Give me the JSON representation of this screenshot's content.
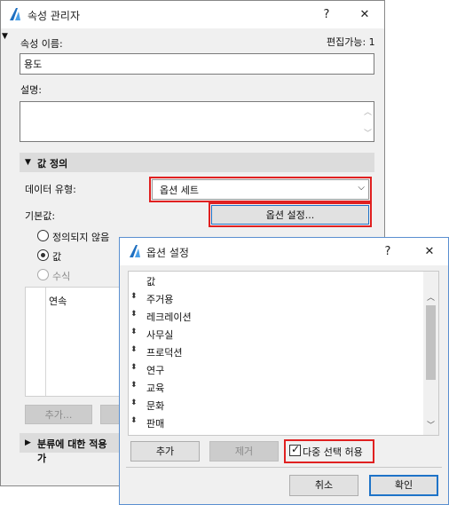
{
  "main": {
    "title": "속성 관리자",
    "help": "?",
    "close": "✕",
    "editable": "편집가능: 1",
    "name_label": "속성 이름:",
    "name_value": "용도",
    "desc_label": "설명:",
    "desc_value": "",
    "value_def": "값 정의",
    "data_type_label": "데이터 유형:",
    "data_type_value": "옵션 세트",
    "default_label": "기본값:",
    "option_settings": "옵션 설정...",
    "radio_undefined": "정의되지 않음",
    "radio_value": "값",
    "radio_formula": "수식",
    "default_value_item": "연속",
    "add_btn": "추가...",
    "classification": "분류에 대한 적용 가"
  },
  "options": {
    "title": "옵션 설정",
    "help": "?",
    "close": "✕",
    "header": "값",
    "items": [
      "주거용",
      "레크레이션",
      "사무실",
      "프로덕션",
      "연구",
      "교육",
      "문화",
      "판매"
    ],
    "add": "추가",
    "remove": "제거",
    "multi_select": "다중 선택 허용",
    "cancel": "취소",
    "ok": "확인"
  },
  "colors": {
    "highlight": "#e02020",
    "focus": "#1e73c8"
  },
  "icons": {
    "app": "archicad-icon",
    "chevron": "chevron-down-icon",
    "handle": "drag-handle-icon"
  }
}
